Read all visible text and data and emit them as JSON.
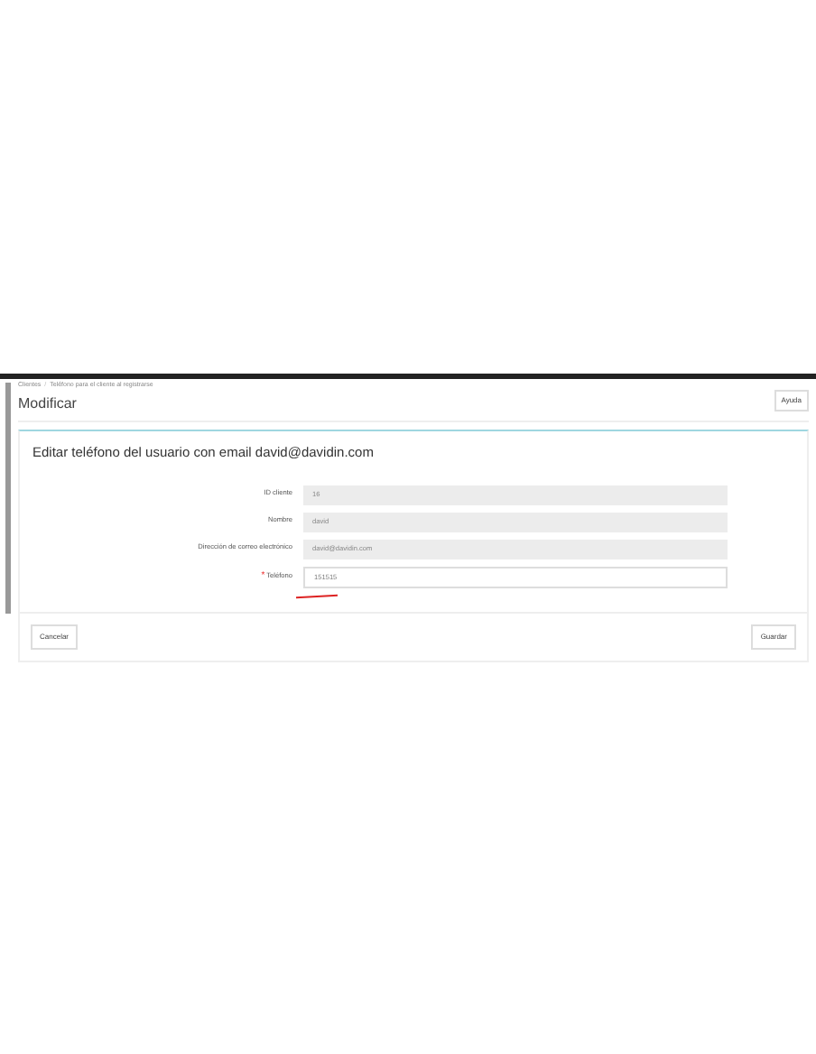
{
  "breadcrumb": {
    "items": [
      "Clientes",
      "Teléfono para el cliente al registrarse"
    ],
    "separator": "/"
  },
  "page_title": "Modificar",
  "help_button": "Ayuda",
  "form": {
    "title": "Editar teléfono del usuario con email david@davidin.com",
    "required_mark": "*",
    "fields": [
      {
        "label": "ID cliente",
        "value": "16",
        "required": false,
        "disabled": true
      },
      {
        "label": "Nombre",
        "value": "david",
        "required": false,
        "disabled": true
      },
      {
        "label": "Dirección de correo electrónico",
        "value": "david@davidin.com",
        "required": false,
        "disabled": true
      },
      {
        "label": "Teléfono",
        "value": "151515",
        "required": true,
        "disabled": false
      }
    ]
  },
  "buttons": [
    "Cancelar",
    "Guardar"
  ]
}
